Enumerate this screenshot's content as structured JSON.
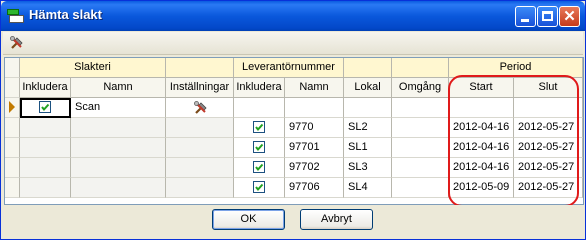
{
  "window": {
    "title": "Hämta slakt"
  },
  "toolbar": {
    "icon": "tools-icon"
  },
  "groups": {
    "slakteri": "Slakteri",
    "leverantor": "Leverantörnummer",
    "period": "Period"
  },
  "columns": {
    "inkludera1": "Inkludera",
    "namn1": "Namn",
    "installningar": "Inställningar",
    "inkludera2": "Inkludera",
    "namn2": "Namn",
    "lokal": "Lokal",
    "omgang": "Omgång",
    "start": "Start",
    "slut": "Slut"
  },
  "slakteri_row": {
    "included": true,
    "name": "Scan",
    "settings_icon": "tools-icon"
  },
  "rows": [
    {
      "included": true,
      "namn": "9770",
      "lokal": "SL2",
      "omgang": "",
      "start": "2012-04-16",
      "slut": "2012-05-27"
    },
    {
      "included": true,
      "namn": "97701",
      "lokal": "SL1",
      "omgang": "",
      "start": "2012-04-16",
      "slut": "2012-05-27"
    },
    {
      "included": true,
      "namn": "97702",
      "lokal": "SL3",
      "omgang": "",
      "start": "2012-04-16",
      "slut": "2012-05-27"
    },
    {
      "included": true,
      "namn": "97706",
      "lokal": "SL4",
      "omgang": "",
      "start": "2012-05-09",
      "slut": "2012-05-27"
    }
  ],
  "buttons": {
    "ok": "OK",
    "cancel": "Avbryt"
  },
  "colors": {
    "titlebar": "#0a58dc",
    "group_header": "#fff7d0",
    "annotation": "#e01a1a"
  }
}
